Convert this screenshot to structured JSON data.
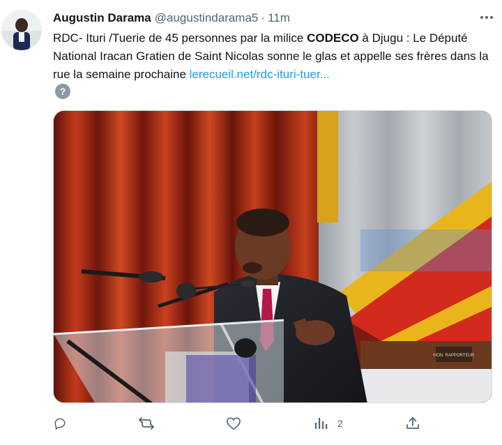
{
  "tweet": {
    "author_name": "Augustin Darama",
    "handle": "@augustindarama5",
    "separator": "·",
    "time": "11m",
    "text_part1": "RDC- Ituri /Tuerie de 45 personnes par la milice ",
    "text_bold": "CODECO",
    "text_part2": " à Djugu : Le Député National Iracan Gratien de Saint Nicolas sonne le glas et appelle ses frères dans la rue la semaine prochaine ",
    "link_text": "lerecueil.net/rdc-ituri-tuer...",
    "hashtag_placeholder": "?",
    "more_icon": "more-horizontal-icon"
  },
  "media": {
    "placard_text": "HON. RAPPORTEUR"
  },
  "actions": {
    "reply_icon": "reply-icon",
    "retweet_icon": "retweet-icon",
    "like_icon": "like-icon",
    "views_icon": "views-icon",
    "views_count": "2",
    "share_icon": "share-icon"
  },
  "colors": {
    "link": "#1d9bf0",
    "secondary_text": "#536471",
    "primary_text": "#0f1419",
    "border": "#cfd9de"
  }
}
